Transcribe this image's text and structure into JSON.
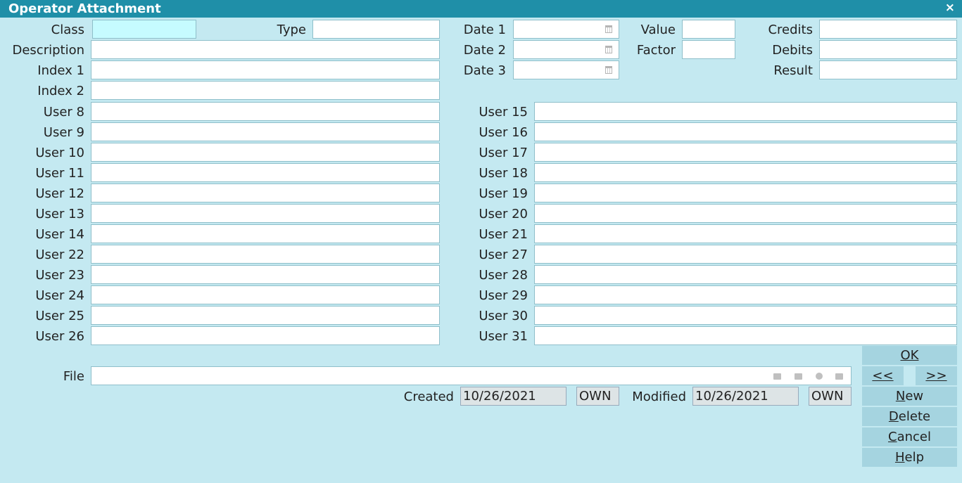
{
  "window": {
    "title": "Operator Attachment",
    "close_label": "×"
  },
  "labels": {
    "class": "Class",
    "type": "Type",
    "description": "Description",
    "index1": "Index 1",
    "index2": "Index 2",
    "date1": "Date 1",
    "date2": "Date 2",
    "date3": "Date 3",
    "value": "Value",
    "factor": "Factor",
    "credits": "Credits",
    "debits": "Debits",
    "result": "Result",
    "file": "File",
    "created": "Created",
    "modified": "Modified"
  },
  "user_left": [
    "User 8",
    "User 9",
    "User 10",
    "User 11",
    "User 12",
    "User 13",
    "User 14",
    "User 22",
    "User 23",
    "User 24",
    "User 25",
    "User 26"
  ],
  "user_right": [
    "User 15",
    "User 16",
    "User 17",
    "User 18",
    "User 19",
    "User 20",
    "User 21",
    "User 27",
    "User 28",
    "User 29",
    "User 30",
    "User 31"
  ],
  "meta": {
    "created_date": "10/26/2021",
    "created_by": "OWN",
    "modified_date": "10/26/2021",
    "modified_by": "OWN"
  },
  "buttons": {
    "ok": "OK",
    "prev": "<<",
    "next": ">>",
    "new_first": "N",
    "new_rest": "ew",
    "delete_first": "D",
    "delete_rest": "elete",
    "cancel_first": "C",
    "cancel_rest": "ancel",
    "help_first": "H",
    "help_rest": "elp"
  },
  "icons": {
    "date_picker": "calendar-icon",
    "file_open": "folder-icon",
    "file_print": "printer-icon",
    "file_clear": "clear-icon",
    "file_lock": "lock-icon"
  }
}
